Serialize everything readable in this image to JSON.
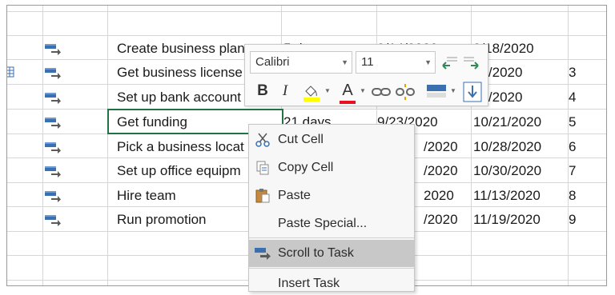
{
  "rows": [
    {
      "name": "Create business plan",
      "duration": "5 days",
      "start": "9/14/2020",
      "finish": "9/18/2020",
      "pred": ""
    },
    {
      "name": "Get business license",
      "duration": "",
      "start": "",
      "finish": "21/2020",
      "pred": "3"
    },
    {
      "name": "Set up bank account",
      "duration": "",
      "start": "",
      "finish": "22/2020",
      "pred": "4"
    },
    {
      "name": "Get funding",
      "duration": "21 days",
      "start": "9/23/2020",
      "finish": "10/21/2020",
      "pred": "5"
    },
    {
      "name": "Pick a business locat",
      "duration": "",
      "start": "/2020",
      "finish": "10/28/2020",
      "pred": "6"
    },
    {
      "name": "Set up office equipm",
      "duration": "",
      "start": "/2020",
      "finish": "10/30/2020",
      "pred": "7"
    },
    {
      "name": "Hire team",
      "duration": "",
      "start": "2020",
      "finish": "11/13/2020",
      "pred": "8"
    },
    {
      "name": "Run promotion",
      "duration": "",
      "start": "/2020",
      "finish": "11/19/2020",
      "pred": "9"
    }
  ],
  "toolbar": {
    "font_name": "Calibri",
    "font_size": "11",
    "bold": "B",
    "italic": "I",
    "font_color": "A"
  },
  "menu": {
    "items": [
      {
        "label": "Cut Cell"
      },
      {
        "label": "Copy Cell"
      },
      {
        "label": "Paste"
      },
      {
        "label": "Paste Special..."
      },
      {
        "label": "Scroll to Task"
      },
      {
        "label": "Insert Task"
      }
    ]
  },
  "colors": {
    "grid": "#d6d6d6",
    "selection_border": "#217346",
    "highlight": "#c8c8c8",
    "font_color_bar": "#e81123",
    "fill_color_bar": "#ffff00",
    "indent_arrow": "#2e8b57"
  },
  "icons": {
    "task_mode": "auto-scheduled-task-icon",
    "cut": "scissors-icon",
    "copy": "copy-icon",
    "paste": "clipboard-icon",
    "scroll": "scroll-to-task-icon"
  }
}
